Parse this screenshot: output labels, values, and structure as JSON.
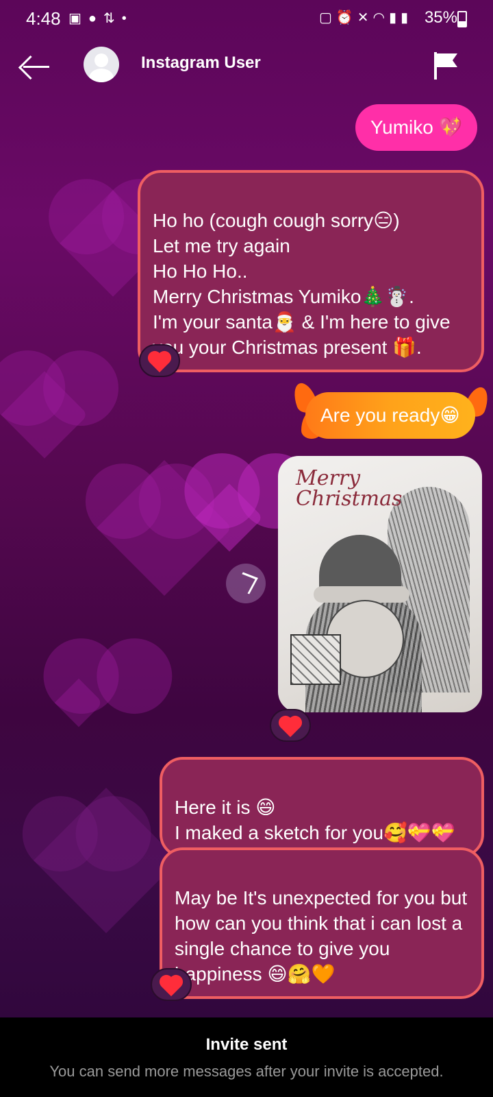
{
  "status_bar": {
    "time": "4:48",
    "battery": "35%",
    "left_icons": [
      "gallery-icon",
      "chat-icon",
      "data-transfer-icon",
      "dot-icon"
    ],
    "right_icons": [
      "battery-saver-icon",
      "alarm-icon",
      "mute-icon",
      "wifi-icon",
      "volte-icon",
      "signal-icon"
    ]
  },
  "header": {
    "username": "Instagram User"
  },
  "messages": [
    {
      "text": "Yumiko 💖"
    },
    {
      "text": "Ho ho (cough cough sorry😑)\nLet me try again\nHo Ho Ho..\nMerry Christmas Yumiko🎄☃️.\nI'm your santa🎅 & I'm here to give you your Christmas present 🎁."
    },
    {
      "text": "Are you ready😁"
    },
    {
      "image_caption": "Merry\nChristmas"
    },
    {
      "text": "Here it is 😄\nI maked a sketch for you🥰💝💝"
    },
    {
      "text": "May be It's unexpected for you but how can you think that i can lost a single chance to give you happiness 😄🤗🧡"
    }
  ],
  "footer": {
    "title": "Invite sent",
    "subtitle": "You can send more messages after your invite is accepted."
  },
  "colors": {
    "pink_bubble": "#ff2fa8",
    "red_bubble": "#8a2556",
    "bubble_border": "#ef5e62",
    "fire_bubble": "#ffa21a"
  }
}
